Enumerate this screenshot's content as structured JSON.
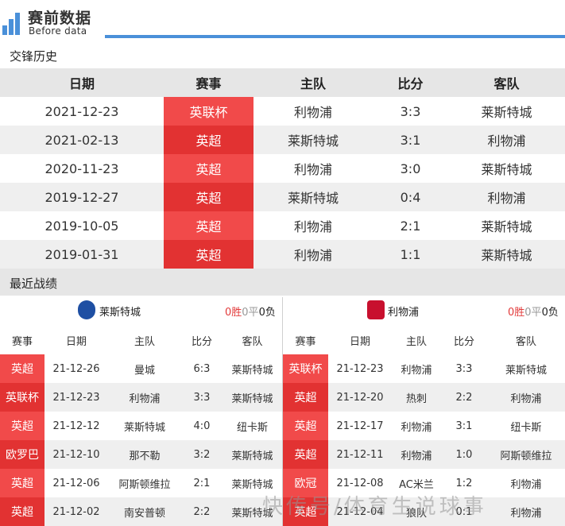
{
  "header": {
    "title": "赛前数据",
    "subtitle": "Before data",
    "accent": "#4a90d9"
  },
  "h2h": {
    "label": "交锋历史",
    "columns": [
      "日期",
      "赛事",
      "主队",
      "比分",
      "客队"
    ],
    "rows": [
      {
        "date": "2021-12-23",
        "comp": "英联杯",
        "home": "利物浦",
        "score": "3:3",
        "away": "莱斯特城",
        "color": "#f14a4a"
      },
      {
        "date": "2021-02-13",
        "comp": "英超",
        "home": "莱斯特城",
        "score": "3:1",
        "away": "利物浦",
        "color": "#e23232"
      },
      {
        "date": "2020-11-23",
        "comp": "英超",
        "home": "利物浦",
        "score": "3:0",
        "away": "莱斯特城",
        "color": "#f14a4a"
      },
      {
        "date": "2019-12-27",
        "comp": "英超",
        "home": "莱斯特城",
        "score": "0:4",
        "away": "利物浦",
        "color": "#e23232"
      },
      {
        "date": "2019-10-05",
        "comp": "英超",
        "home": "利物浦",
        "score": "2:1",
        "away": "莱斯特城",
        "color": "#f14a4a"
      },
      {
        "date": "2019-01-31",
        "comp": "英超",
        "home": "利物浦",
        "score": "1:1",
        "away": "莱斯特城",
        "color": "#e23232"
      }
    ]
  },
  "recent": {
    "label": "最近战绩",
    "columns": [
      "赛事",
      "日期",
      "主队",
      "比分",
      "客队"
    ],
    "left": {
      "team": "莱斯特城",
      "w": "0胜",
      "d": "0平",
      "l": "0负",
      "crest_color": "#1e4fa3",
      "rows": [
        {
          "comp": "英超",
          "date": "21-12-26",
          "home": "曼城",
          "score": "6:3",
          "away": "莱斯特城",
          "color": "#f14a4a"
        },
        {
          "comp": "英联杯",
          "date": "21-12-23",
          "home": "利物浦",
          "score": "3:3",
          "away": "莱斯特城",
          "color": "#e23232"
        },
        {
          "comp": "英超",
          "date": "21-12-12",
          "home": "莱斯特城",
          "score": "4:0",
          "away": "纽卡斯",
          "color": "#f14a4a"
        },
        {
          "comp": "欧罗巴",
          "date": "21-12-10",
          "home": "那不勒",
          "score": "3:2",
          "away": "莱斯特城",
          "color": "#e23232"
        },
        {
          "comp": "英超",
          "date": "21-12-06",
          "home": "阿斯顿维拉",
          "score": "2:1",
          "away": "莱斯特城",
          "color": "#f14a4a"
        },
        {
          "comp": "英超",
          "date": "21-12-02",
          "home": "南安普顿",
          "score": "2:2",
          "away": "莱斯特城",
          "color": "#e23232"
        }
      ]
    },
    "right": {
      "team": "利物浦",
      "w": "0胜",
      "d": "0平",
      "l": "0负",
      "crest_color": "#c8102e",
      "rows": [
        {
          "comp": "英联杯",
          "date": "21-12-23",
          "home": "利物浦",
          "score": "3:3",
          "away": "莱斯特城",
          "color": "#f14a4a"
        },
        {
          "comp": "英超",
          "date": "21-12-20",
          "home": "热刺",
          "score": "2:2",
          "away": "利物浦",
          "color": "#e23232"
        },
        {
          "comp": "英超",
          "date": "21-12-17",
          "home": "利物浦",
          "score": "3:1",
          "away": "纽卡斯",
          "color": "#f14a4a"
        },
        {
          "comp": "英超",
          "date": "21-12-11",
          "home": "利物浦",
          "score": "1:0",
          "away": "阿斯顿维拉",
          "color": "#e23232"
        },
        {
          "comp": "欧冠",
          "date": "21-12-08",
          "home": "AC米兰",
          "score": "1:2",
          "away": "利物浦",
          "color": "#f14a4a"
        },
        {
          "comp": "英超",
          "date": "21-12-04",
          "home": "狼队",
          "score": "0:1",
          "away": "利物浦",
          "color": "#e23232"
        }
      ]
    }
  },
  "watermark": "快传号/体育生说球事"
}
